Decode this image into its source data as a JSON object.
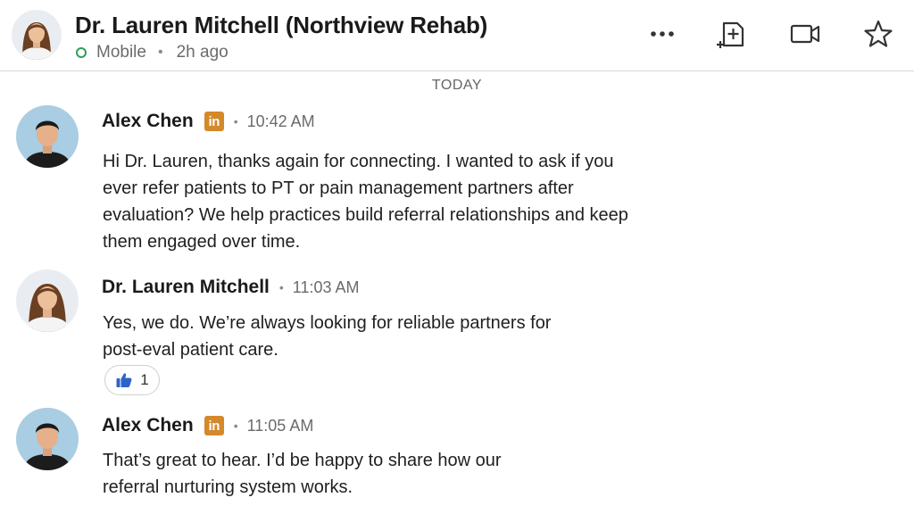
{
  "header": {
    "title": "Dr. Lauren Mitchell (Northview Rehab)",
    "status": "Mobile",
    "last_seen": "2h ago",
    "icons": [
      "more-icon",
      "add-note-icon",
      "video-call-icon",
      "star-icon"
    ],
    "status_color": "#2e9e5b"
  },
  "date_divider": "TODAY",
  "messages": [
    {
      "sender": "Alex Chen",
      "badge": "in",
      "time": "10:42 AM",
      "lines": [
        "Hi Dr. Lauren, thanks again for connecting. I wanted to ask if you",
        "ever refer patients to PT or pain management partners after",
        "evaluation? We help practices build referral relationships and keep",
        "them engaged over time."
      ]
    },
    {
      "sender": "Dr. Lauren Mitchell",
      "time": "11:03 AM",
      "lines": [
        "Yes, we do. We’re always looking for reliable partners for",
        "post-eval patient care."
      ],
      "reaction": {
        "icon": "thumbs-up-icon",
        "count": "1"
      }
    },
    {
      "sender": "Alex Chen",
      "badge": "in",
      "time": "11:05 AM",
      "lines": [
        "That’s great to hear. I’d be happy to share how our",
        "referral nurturing system works."
      ]
    }
  ],
  "colors": {
    "linkedin_badge": "#d4892a",
    "reaction_thumb": "#2d63c8"
  }
}
